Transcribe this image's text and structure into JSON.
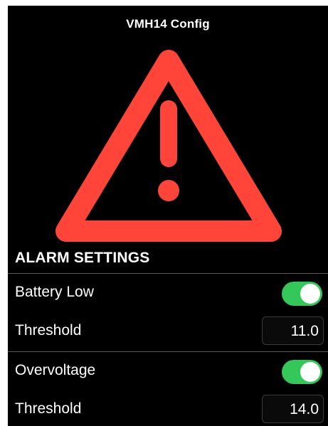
{
  "header": {
    "title": "VMH14 Config"
  },
  "hero": {
    "icon": "warning-triangle-icon",
    "color": "#ff453a"
  },
  "section": {
    "title": "ALARM SETTINGS"
  },
  "alarms": [
    {
      "label": "Battery Low",
      "enabled": true,
      "threshold_label": "Threshold",
      "threshold_value": "11.0"
    },
    {
      "label": "Overvoltage",
      "enabled": true,
      "threshold_label": "Threshold",
      "threshold_value": "14.0"
    }
  ],
  "colors": {
    "background": "#000000",
    "toggle_on": "#34c759",
    "accent_warning": "#ff453a",
    "divider": "#5a5a5e"
  }
}
